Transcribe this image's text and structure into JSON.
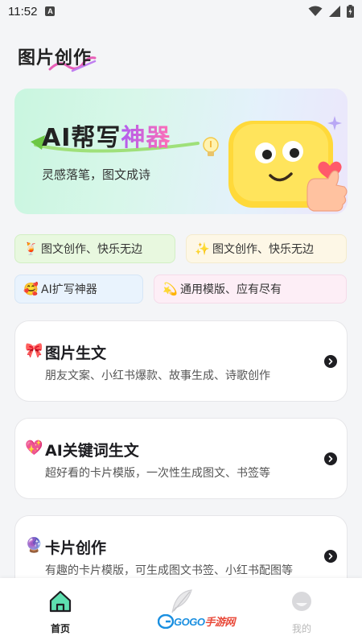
{
  "status_bar": {
    "time": "11:52",
    "notif_badge": "A",
    "icons": [
      "wifi-icon",
      "signal-icon",
      "battery-icon"
    ]
  },
  "page": {
    "title": "图片创作"
  },
  "banner": {
    "title_part1": "AI帮写",
    "title_part2": "神器",
    "subtitle": "灵感落笔，图文成诗"
  },
  "chips": [
    {
      "emoji": "🍹",
      "label": "图文创作、快乐无边"
    },
    {
      "emoji": "✨",
      "label": "图文创作、快乐无边"
    },
    {
      "emoji": "🥰",
      "label": "AI扩写神器"
    },
    {
      "emoji": "💫",
      "label": "通用模版、应有尽有"
    }
  ],
  "cards": [
    {
      "emoji": "🎀",
      "title": "图片生文",
      "desc": "朋友文案、小红书爆款、故事生成、诗歌创作"
    },
    {
      "emoji": "💖",
      "title": "AI关键词生文",
      "desc": "超好看的卡片模版，一次性生成图文、书签等"
    },
    {
      "emoji": "🔮",
      "title": "卡片创作",
      "desc": "有趣的卡片模版，可生成图文书签、小红书配图等"
    }
  ],
  "nav": {
    "home_label": "首页",
    "mine_label": "我的"
  },
  "watermark": {
    "text_a": "GOGO",
    "text_b": "手游网"
  },
  "colors": {
    "accent": "#b05cf0",
    "pink": "#ff6fb5",
    "banner_green": "#c9f6df"
  }
}
